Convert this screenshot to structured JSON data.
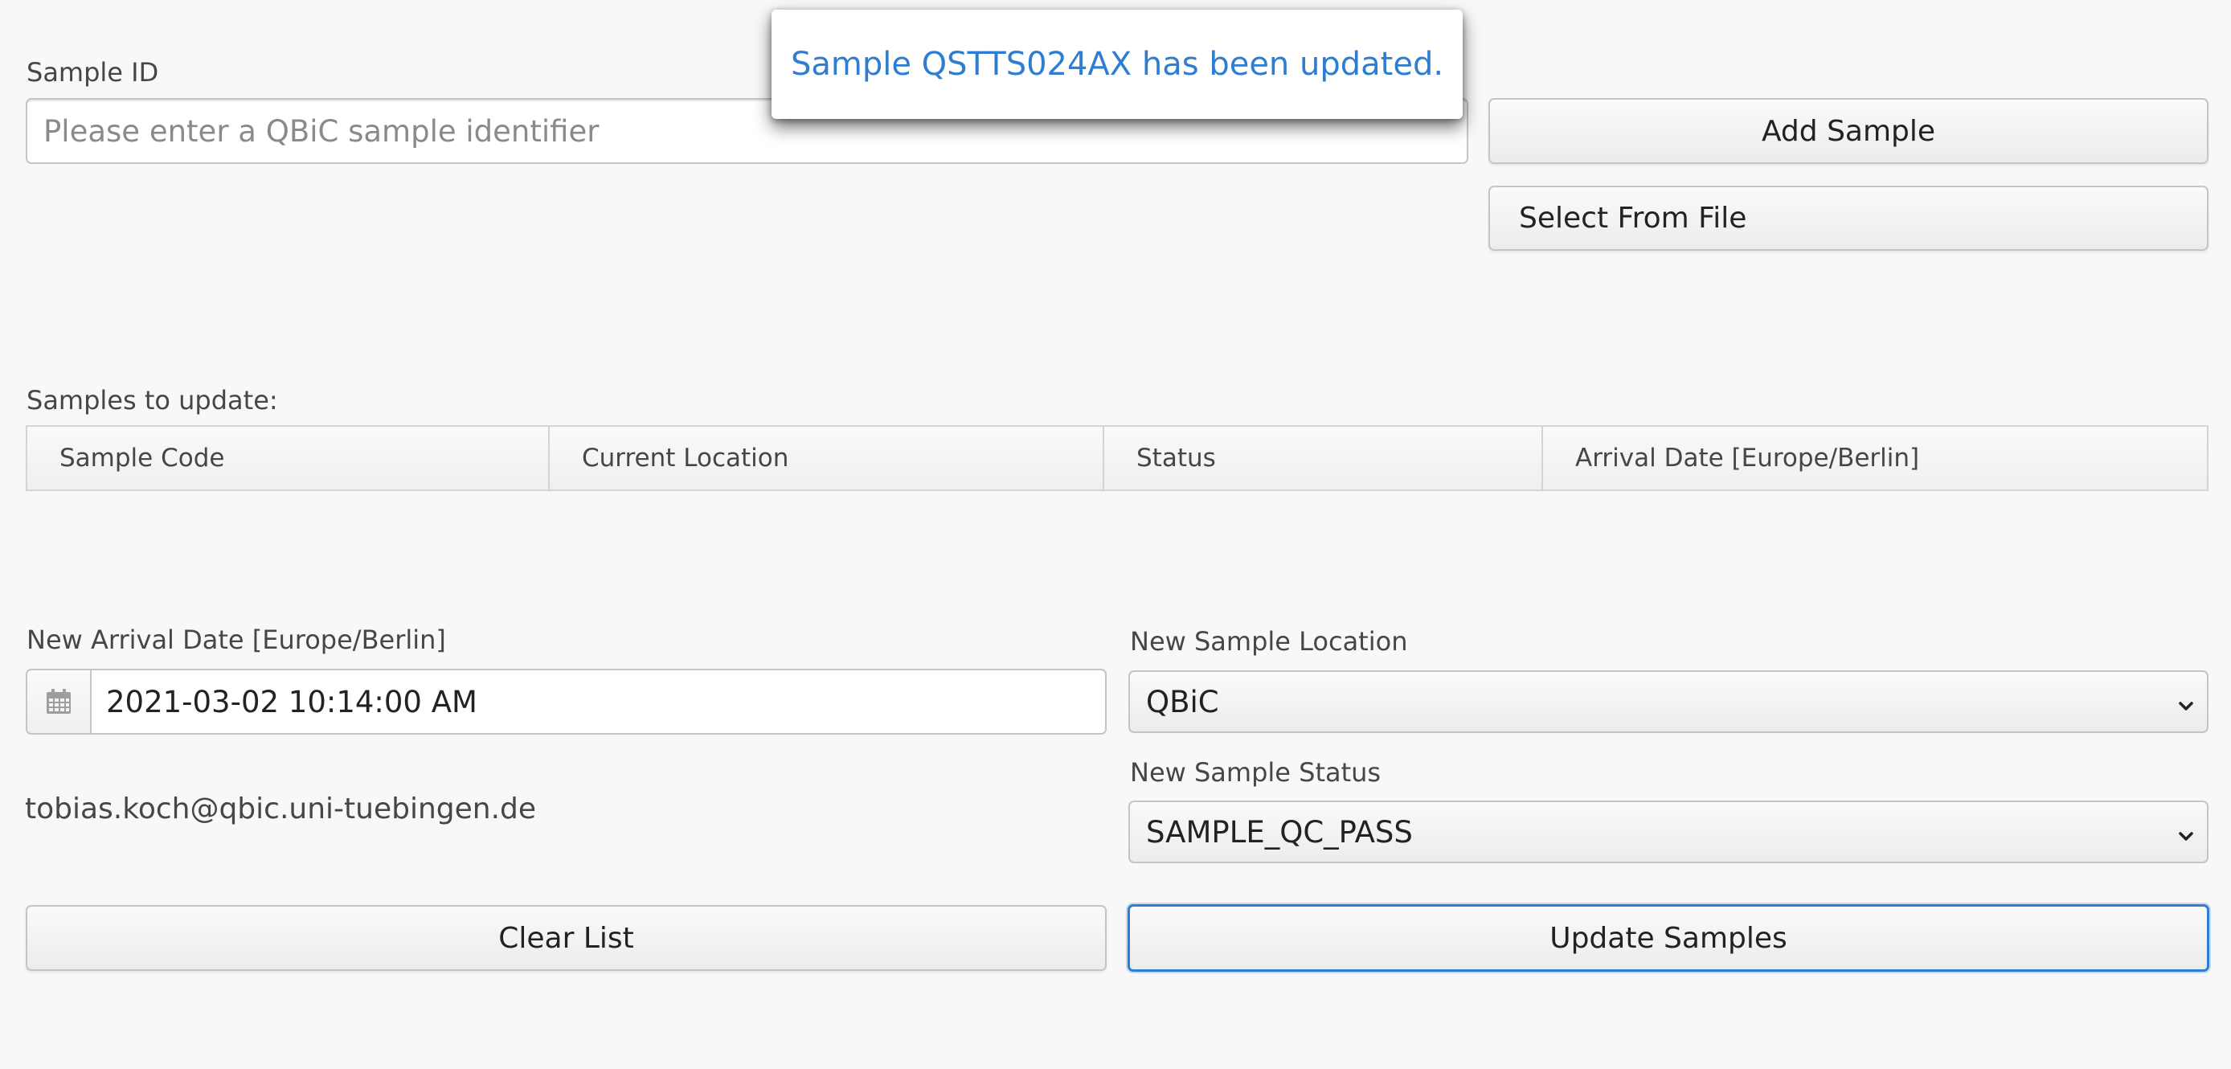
{
  "sample_id": {
    "label": "Sample ID",
    "placeholder": "Please enter a QBiC sample identifier",
    "value": ""
  },
  "notification": {
    "message": "Sample QSTTS024AX has been updated."
  },
  "buttons": {
    "add_sample": "Add Sample",
    "select_from_file": "Select From File",
    "clear_list": "Clear List",
    "update_samples": "Update Samples"
  },
  "samples_table": {
    "caption": "Samples to update:",
    "columns": [
      "Sample Code",
      "Current Location",
      "Status",
      "Arrival Date [Europe/Berlin]"
    ],
    "rows": []
  },
  "arrival_date": {
    "label": "New Arrival Date [Europe/Berlin]",
    "value": "2021-03-02 10:14:00 AM",
    "icon": "calendar-icon"
  },
  "sample_location": {
    "label": "New Sample Location",
    "selected": "QBiC",
    "icon": "chevron-down-icon"
  },
  "sample_status": {
    "label": "New Sample Status",
    "selected": "SAMPLE_QC_PASS",
    "icon": "chevron-down-icon"
  },
  "user": {
    "email": "tobias.koch@qbic.uni-tuebingen.de"
  },
  "colors": {
    "background": "#f8f8f8",
    "notification_text": "#2f7dd0",
    "focus_border": "#2d7dd2"
  }
}
